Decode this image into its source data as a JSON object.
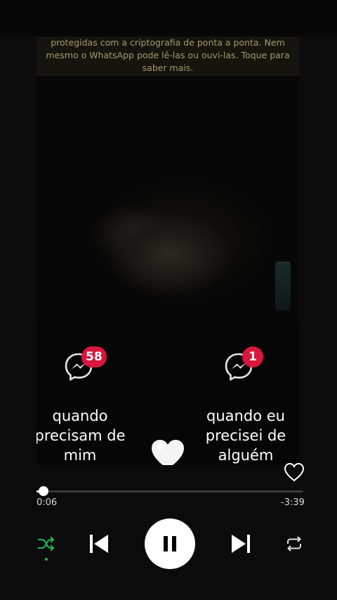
{
  "notice": {
    "line1": "protegidas com a criptografia de ponta a ponta. Nem",
    "line2": "mesmo o WhatsApp pode lê-las ou ouvi-las. Toque para",
    "line3": "saber mais."
  },
  "left_message": {
    "icon": "messenger-icon",
    "badge": "58",
    "caption": "quando\nprecisam de\nmim"
  },
  "right_message": {
    "icon": "messenger-icon",
    "badge": "1",
    "caption": "quando eu\nprecisei de\nalguém"
  },
  "center_icon": "white-heart-icon",
  "player": {
    "elapsed": "0:06",
    "remaining": "-3:39",
    "progress_fraction": 0.027,
    "shuffle_active": true,
    "liked": false,
    "colors": {
      "accent": "#1db954",
      "badge": "#d9163e"
    }
  }
}
